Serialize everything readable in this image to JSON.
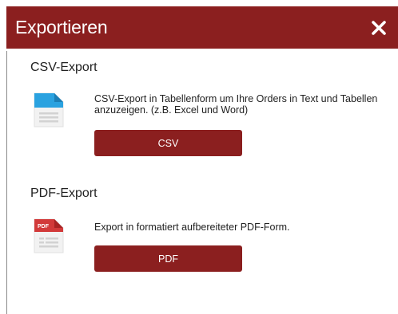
{
  "dialog": {
    "title": "Exportieren",
    "close_icon": "close-icon"
  },
  "csv": {
    "section_title": "CSV-Export",
    "description": "CSV-Export in Tabellenform um Ihre Orders in Text und Tabellen anzuzeigen. (z.B. Excel und Word)",
    "button_label": "CSV",
    "icon": "csv-file-icon"
  },
  "pdf": {
    "section_title": "PDF-Export",
    "description": "Export in formatiert aufbereiteter PDF-Form.",
    "button_label": "PDF",
    "icon": "pdf-file-icon",
    "icon_badge": "PDF"
  },
  "colors": {
    "brand": "#8b1f1f",
    "csv_accent": "#2aa2e0",
    "pdf_accent": "#d23a3a"
  }
}
